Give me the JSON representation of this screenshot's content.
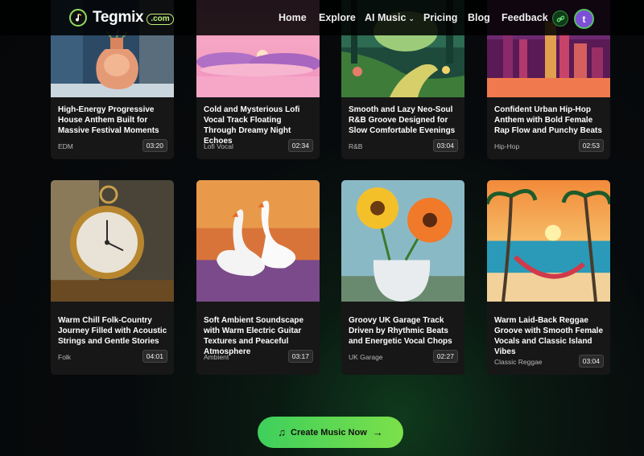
{
  "header": {
    "logo_text": "Tegmix",
    "logo_badge": ".com",
    "nav": {
      "home": "Home",
      "explore": "Explore",
      "ai_music": "AI Music",
      "pricing": "Pricing",
      "blog": "Blog",
      "feedback": "Feedback"
    },
    "avatar_letter": "t"
  },
  "cards": [
    {
      "title": "High-Energy Progressive House Anthem Built for Massive Festival Moments",
      "genre": "EDM",
      "duration": "03:20"
    },
    {
      "title": "Cold and Mysterious Lofi Vocal Track Floating Through Dreamy Night Echoes",
      "genre": "Lofi Vocal",
      "duration": "02:34"
    },
    {
      "title": "Smooth and Lazy Neo-Soul R&B Groove Designed for Slow Comfortable Evenings",
      "genre": "R&B",
      "duration": "03:04"
    },
    {
      "title": "Confident Urban Hip-Hop Anthem with Bold Female Rap Flow and Punchy Beats",
      "genre": "Hip-Hop",
      "duration": "02:53"
    },
    {
      "title": "Warm Chill Folk-Country Journey Filled with Acoustic Strings and Gentle Stories",
      "genre": "Folk",
      "duration": "04:01"
    },
    {
      "title": "Soft Ambient Soundscape with Warm Electric Guitar Textures and Peaceful Atmosphere",
      "genre": "Ambient",
      "duration": "03:17"
    },
    {
      "title": "Groovy UK Garage Track Driven by Rhythmic Beats and Energetic Vocal Chops",
      "genre": "UK Garage",
      "duration": "02:27"
    },
    {
      "title": "Warm Laid-Back Reggae Groove with Smooth Female Vocals and Classic Island Vibes",
      "genre": "Classic Reggae",
      "duration": "03:04"
    }
  ],
  "cta": {
    "label": "Create Music Now",
    "note_icon": "music-note-icon",
    "arrow_icon": "arrow-right-icon"
  },
  "colors": {
    "accent": "#4ccf5a",
    "card_bg": "#171717",
    "avatar": "#7d4fd6"
  }
}
